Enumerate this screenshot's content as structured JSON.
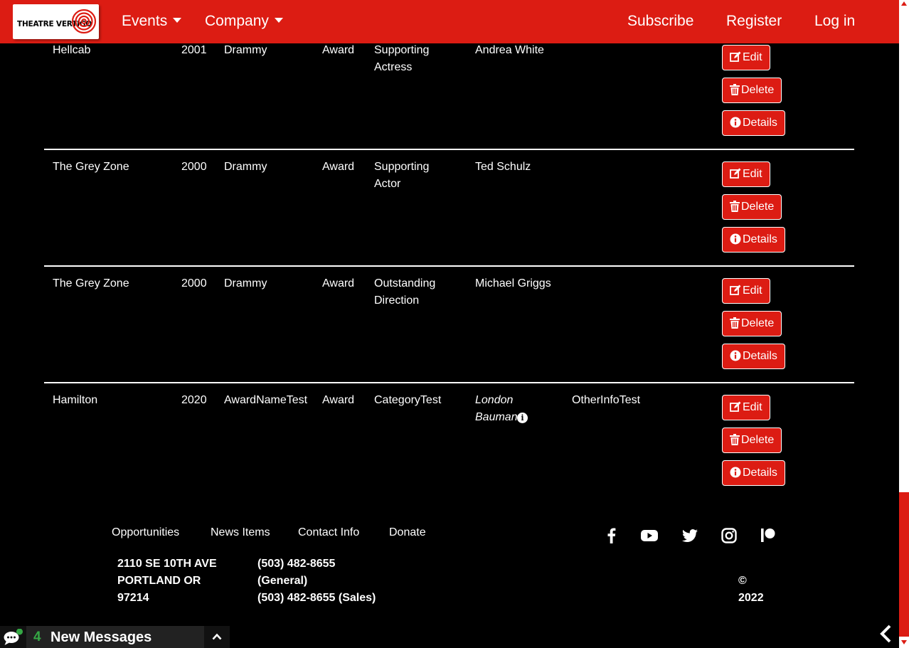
{
  "navbar": {
    "logo_text": "THEATRE VERTIGO",
    "events_label": "Events",
    "company_label": "Company",
    "subscribe_label": "Subscribe",
    "register_label": "Register",
    "login_label": "Log in"
  },
  "awards": {
    "rows": [
      {
        "show": "Hellcab",
        "year": "2001",
        "award_name": "Drammy",
        "type": "Award",
        "category_line1": "Supporting",
        "category_line2": "Actress",
        "recipient_line1": "Andrea White",
        "recipient_line2": "",
        "other_info": ""
      },
      {
        "show": "The Grey Zone",
        "year": "2000",
        "award_name": "Drammy",
        "type": "Award",
        "category_line1": "Supporting",
        "category_line2": "Actor",
        "recipient_line1": "Ted Schulz",
        "recipient_line2": "",
        "other_info": ""
      },
      {
        "show": "The Grey Zone",
        "year": "2000",
        "award_name": "Drammy",
        "type": "Award",
        "category_line1": "Outstanding",
        "category_line2": "Direction",
        "recipient_line1": "Michael Griggs",
        "recipient_line2": "",
        "other_info": ""
      },
      {
        "show": "Hamilton",
        "year": "2020",
        "award_name": "AwardNameTest",
        "type": "Award",
        "category_line1": "CategoryTest",
        "category_line2": "",
        "recipient_line1": "London",
        "recipient_line2": "Bauman",
        "other_info": "OtherInfoTest"
      }
    ],
    "edit_label": "Edit",
    "delete_label": "Delete",
    "details_label": "Details"
  },
  "footer": {
    "links": [
      "Opportunities",
      "News Items",
      "Contact Info",
      "Donate"
    ],
    "social_icons": [
      "facebook-icon",
      "youtube-icon",
      "twitter-icon",
      "instagram-icon",
      "patreon-icon"
    ],
    "address_line1": "2110 SE 10TH AVE",
    "address_line2": "PORTLAND OR",
    "address_line3": "97214",
    "phone_general_line1": "(503) 482-8655",
    "phone_general_line2": "(General)",
    "phone_sales": "(503) 482-8655 (Sales)",
    "copyright_symbol": "©",
    "copyright_year": "2022"
  },
  "messages": {
    "count": "4",
    "label": "New Messages"
  },
  "colors": {
    "brand_red": "#dc1c13",
    "background": "#000000",
    "message_count_green": "#35a845"
  }
}
